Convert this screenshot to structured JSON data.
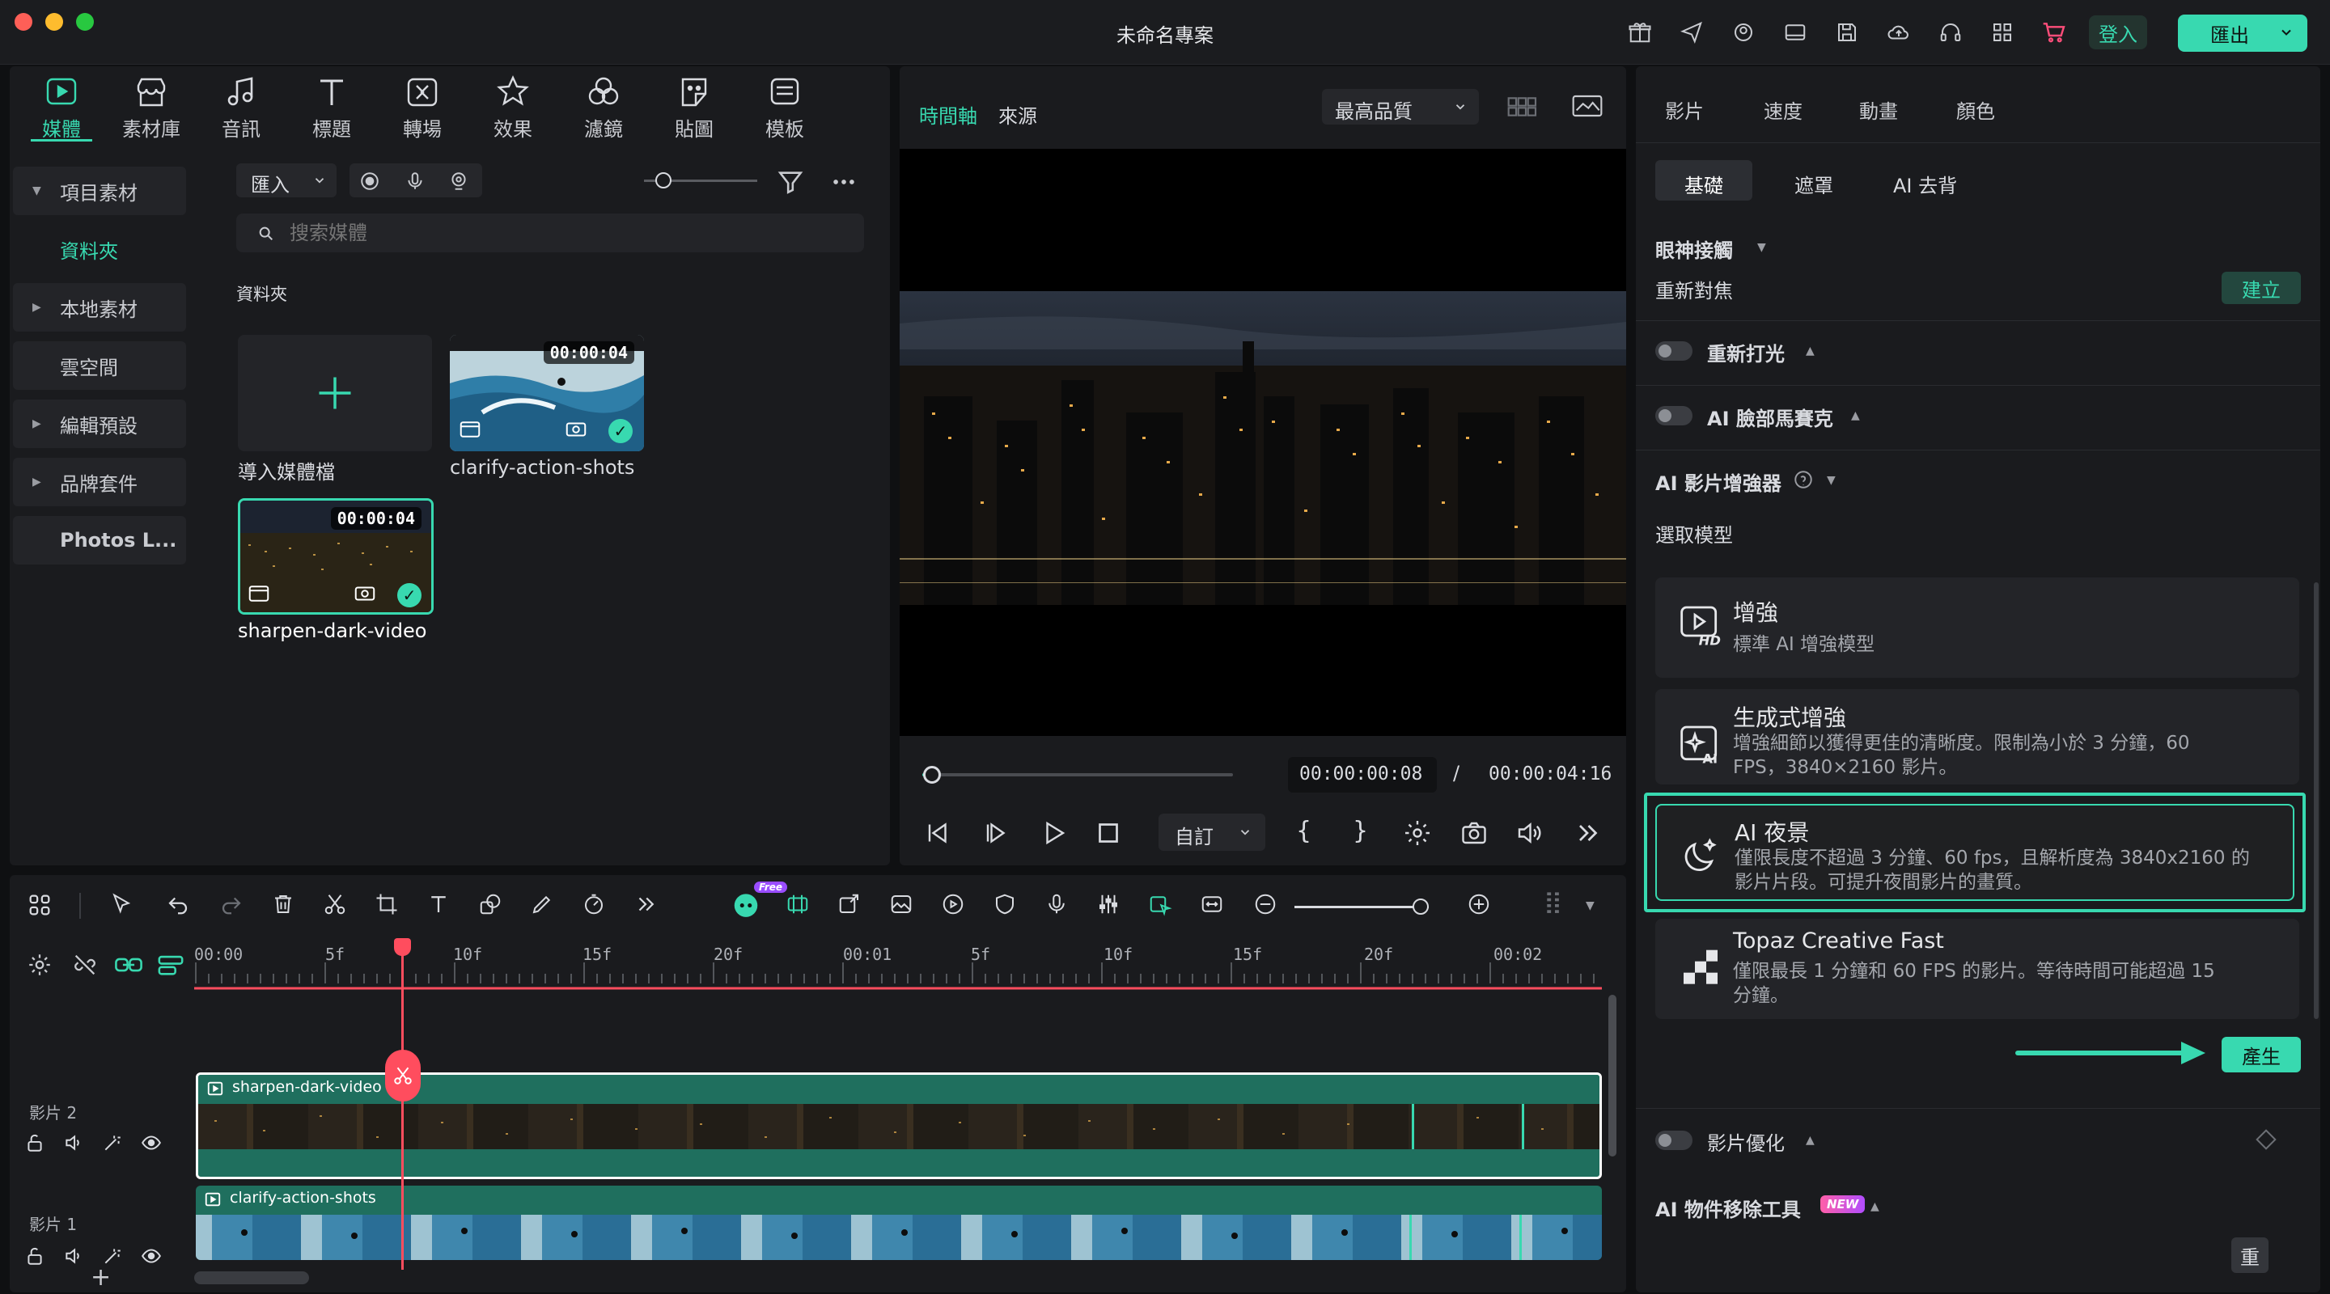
{
  "window": {
    "title": "未命名專案"
  },
  "topbar": {
    "login_label": "登入",
    "export_label": "匯出"
  },
  "nav": [
    {
      "label": "媒體"
    },
    {
      "label": "素材庫"
    },
    {
      "label": "音訊"
    },
    {
      "label": "標題"
    },
    {
      "label": "轉場"
    },
    {
      "label": "效果"
    },
    {
      "label": "濾鏡"
    },
    {
      "label": "貼圖"
    },
    {
      "label": "模板"
    }
  ],
  "sidebar": [
    {
      "label": "項目素材"
    },
    {
      "label": "資料夾"
    },
    {
      "label": "本地素材"
    },
    {
      "label": "雲空間"
    },
    {
      "label": "編輯預設"
    },
    {
      "label": "品牌套件"
    },
    {
      "label": "Photos L..."
    }
  ],
  "media": {
    "import_label": "匯入",
    "search_placeholder": "搜索媒體",
    "folder_label": "資料夾",
    "import_tile_label": "導入媒體檔",
    "items": [
      {
        "name": "clarify-action-shots",
        "duration": "00:00:04"
      },
      {
        "name": "sharpen-dark-video",
        "duration": "00:00:04"
      }
    ]
  },
  "preview": {
    "tab_timeline": "時間軸",
    "tab_source": "來源",
    "quality": "最高品質",
    "current_time": "00:00:00:08",
    "separator": "/",
    "total_time": "00:00:04:16",
    "ratio_label": "自訂",
    "progress": 0.03
  },
  "right": {
    "tabs": [
      "影片",
      "速度",
      "動畫",
      "顏色"
    ],
    "subtabs": [
      "基礎",
      "遮罩",
      "AI 去背"
    ],
    "eye_contact": "眼神接觸",
    "refocus": "重新對焦",
    "create": "建立",
    "relight": "重新打光",
    "face_mosaic": "AI 臉部馬賽克",
    "enhancer": "AI 影片增強器",
    "choose_model": "選取模型",
    "models": [
      {
        "title": "增強",
        "desc": "標準 AI 增強模型"
      },
      {
        "title": "生成式增強",
        "desc": "增強細節以獲得更佳的清晰度。限制為小於 3 分鐘，60 FPS，3840×2160 影片。"
      },
      {
        "title": "AI 夜景",
        "desc": "僅限長度不超過 3 分鐘、60 fps，且解析度為 3840x2160 的影片片段。可提升夜間影片的畫質。"
      },
      {
        "title": "Topaz Creative Fast",
        "desc": "僅限最長 1 分鐘和 60 FPS 的影片。等待時間可能超過 15 分鐘。"
      }
    ],
    "generate": "產生",
    "optimize": "影片優化",
    "object_removal": "AI 物件移除工具",
    "new_badge": "NEW",
    "reset": "重"
  },
  "timeline": {
    "free_badge": "Free",
    "ruler": [
      "00:00",
      "5f",
      "10f",
      "15f",
      "20f",
      "00:01",
      "5f",
      "10f",
      "15f",
      "20f",
      "00:02"
    ],
    "tracks": [
      {
        "label": "影片 2",
        "clip": "sharpen-dark-video"
      },
      {
        "label": "影片 1",
        "clip": "clarify-action-shots"
      }
    ]
  }
}
